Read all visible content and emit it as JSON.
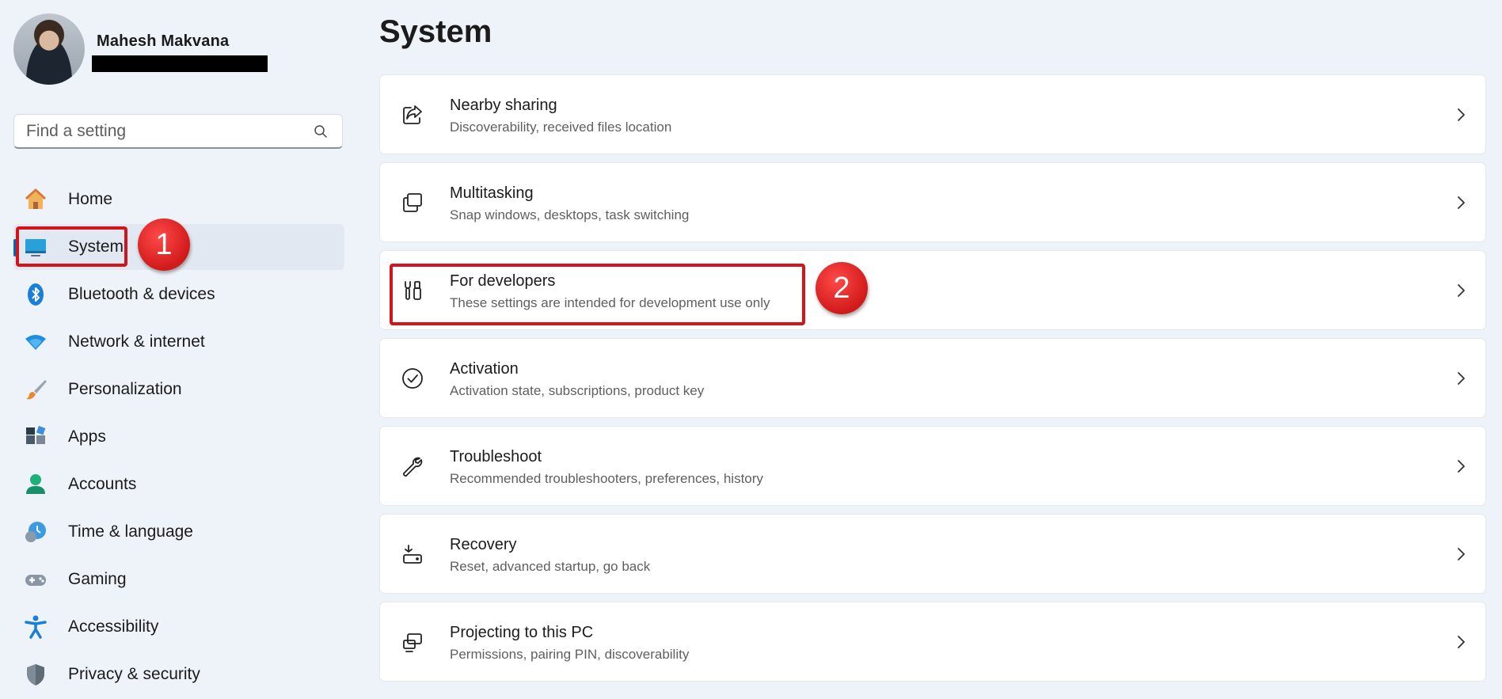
{
  "profile": {
    "name": "Mahesh Makvana",
    "email_redacted": true
  },
  "search": {
    "placeholder": "Find a setting",
    "icon": "search-icon"
  },
  "sidebar": {
    "items": [
      {
        "label": "Home",
        "icon": "home-icon",
        "active": false
      },
      {
        "label": "System",
        "icon": "system-icon",
        "active": true
      },
      {
        "label": "Bluetooth & devices",
        "icon": "bluetooth-icon",
        "active": false
      },
      {
        "label": "Network & internet",
        "icon": "wifi-icon",
        "active": false
      },
      {
        "label": "Personalization",
        "icon": "brush-icon",
        "active": false
      },
      {
        "label": "Apps",
        "icon": "apps-icon",
        "active": false
      },
      {
        "label": "Accounts",
        "icon": "accounts-icon",
        "active": false
      },
      {
        "label": "Time & language",
        "icon": "time-language-icon",
        "active": false
      },
      {
        "label": "Gaming",
        "icon": "gamepad-icon",
        "active": false
      },
      {
        "label": "Accessibility",
        "icon": "accessibility-icon",
        "active": false
      },
      {
        "label": "Privacy & security",
        "icon": "shield-icon",
        "active": false
      }
    ]
  },
  "main": {
    "title": "System",
    "rows": [
      {
        "title": "Nearby sharing",
        "subtitle": "Discoverability, received files location",
        "icon": "share-icon"
      },
      {
        "title": "Multitasking",
        "subtitle": "Snap windows, desktops, task switching",
        "icon": "multitasking-icon"
      },
      {
        "title": "For developers",
        "subtitle": "These settings are intended for development use only",
        "icon": "developer-tools-icon"
      },
      {
        "title": "Activation",
        "subtitle": "Activation state, subscriptions, product key",
        "icon": "check-circle-icon"
      },
      {
        "title": "Troubleshoot",
        "subtitle": "Recommended troubleshooters, preferences, history",
        "icon": "wrench-icon"
      },
      {
        "title": "Recovery",
        "subtitle": "Reset, advanced startup, go back",
        "icon": "recovery-icon"
      },
      {
        "title": "Projecting to this PC",
        "subtitle": "Permissions, pairing PIN, discoverability",
        "icon": "projecting-icon"
      }
    ]
  },
  "annotations": {
    "step1": "1",
    "step2": "2",
    "color": "#d4131b"
  },
  "colors": {
    "accent": "#0067c0",
    "background": "#eef3fa"
  }
}
